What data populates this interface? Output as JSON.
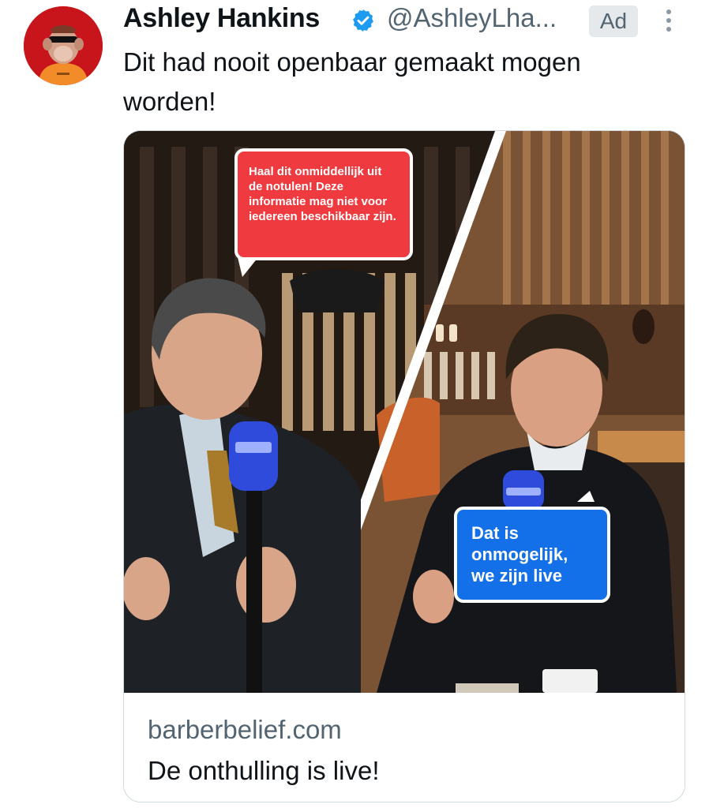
{
  "tweet": {
    "author_name": "Ashley Hankins",
    "handle": "@AshleyLha...",
    "ad_label": "Ad",
    "text": "Dit had nooit openbaar gemaakt mogen worden!"
  },
  "card": {
    "domain": "barberbelief.com",
    "title": "De onthulling is live!",
    "image": {
      "bubble_left_text": "Haal dit onmiddellijk uit de notulen! Deze informatie mag niet voor iedereen beschikbaar zijn.",
      "bubble_right_text": "Dat is onmogelijk, we zijn live",
      "mic_logo": "ewn"
    }
  },
  "colors": {
    "accent_verified": "#1d9bf0",
    "bubble_red": "#ef3b3f",
    "bubble_blue": "#1470e8",
    "avatar_bg": "#c8141b"
  },
  "icons": {
    "verified": "verified-badge-icon",
    "more": "more-options-icon"
  }
}
